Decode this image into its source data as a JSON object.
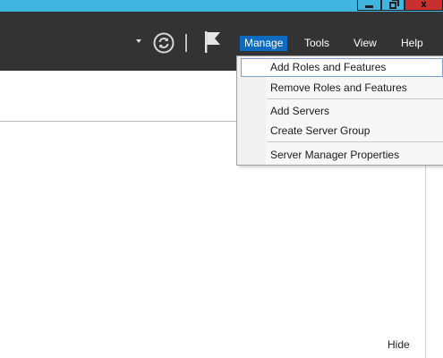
{
  "window_controls": {
    "minimize_icon": "minimize-icon",
    "maximize_icon": "maximize-icon",
    "close_label": "x"
  },
  "header": {
    "refresh_icon": "refresh-icon",
    "flag_icon": "notifications-flag-icon",
    "menu": [
      {
        "label": "Manage",
        "active": true
      },
      {
        "label": "Tools",
        "active": false
      },
      {
        "label": "View",
        "active": false
      },
      {
        "label": "Help",
        "active": false
      }
    ]
  },
  "manage_menu": {
    "items": [
      {
        "label": "Add Roles and Features",
        "highlighted": true
      },
      {
        "label": "Remove Roles and Features",
        "highlighted": false
      },
      {
        "label": "Add Servers",
        "highlighted": false
      },
      {
        "label": "Create Server Group",
        "highlighted": false
      },
      {
        "label": "Server Manager Properties",
        "highlighted": false
      }
    ]
  },
  "body": {
    "hide_label": "Hide"
  },
  "colors": {
    "titlebar": "#3fb5e0",
    "header_bg": "#333333",
    "menu_active": "#0e6cc0",
    "close_button": "#c7302f"
  }
}
